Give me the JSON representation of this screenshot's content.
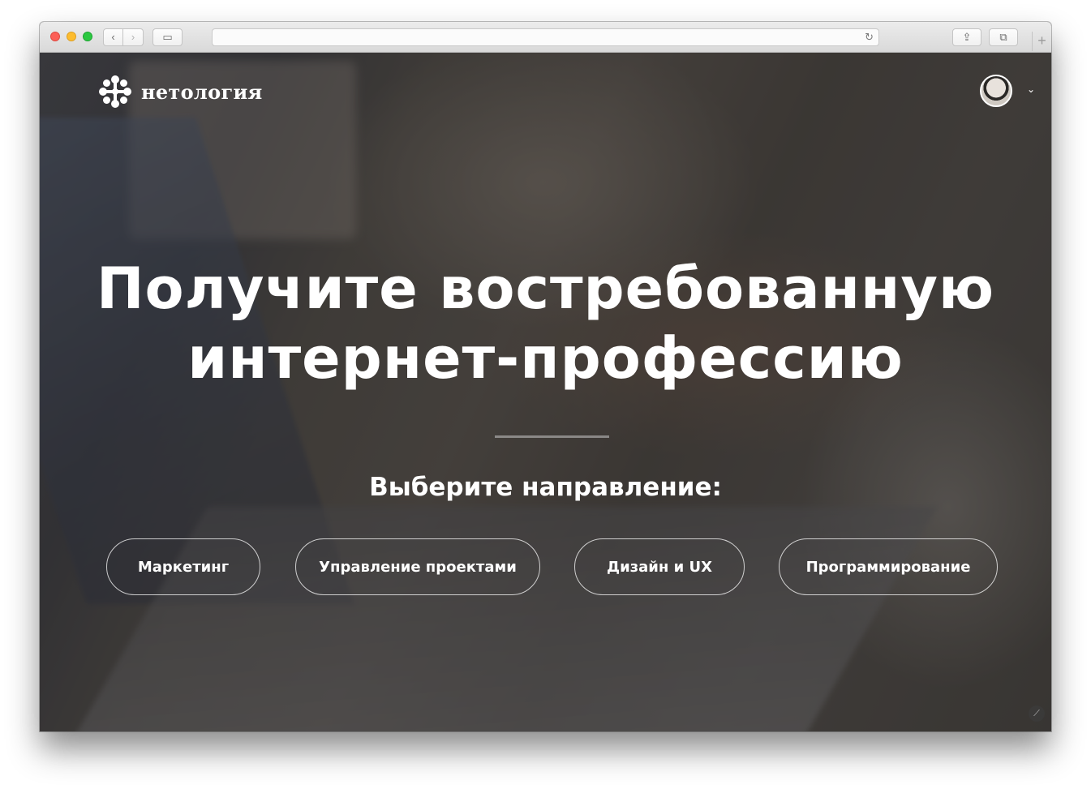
{
  "browser": {
    "back_glyph": "‹",
    "forward_glyph": "›",
    "sidebar_glyph": "▭",
    "reload_glyph": "↻",
    "share_glyph": "⇪",
    "tabs_glyph": "⧉",
    "new_tab_glyph": "+",
    "address_value": ""
  },
  "site": {
    "logo_text": "нетология",
    "logo_icon": "asterisk-flower-icon"
  },
  "hero": {
    "headline": "Получите востребованную интернет-профессию",
    "subheadline": "Выберите направление:",
    "directions": [
      {
        "label": "Маркетинг"
      },
      {
        "label": "Управление проектами"
      },
      {
        "label": "Дизайн и UX"
      },
      {
        "label": "Программирование"
      }
    ]
  },
  "colors": {
    "text": "#ffffff",
    "button_border": "#ffffff"
  }
}
